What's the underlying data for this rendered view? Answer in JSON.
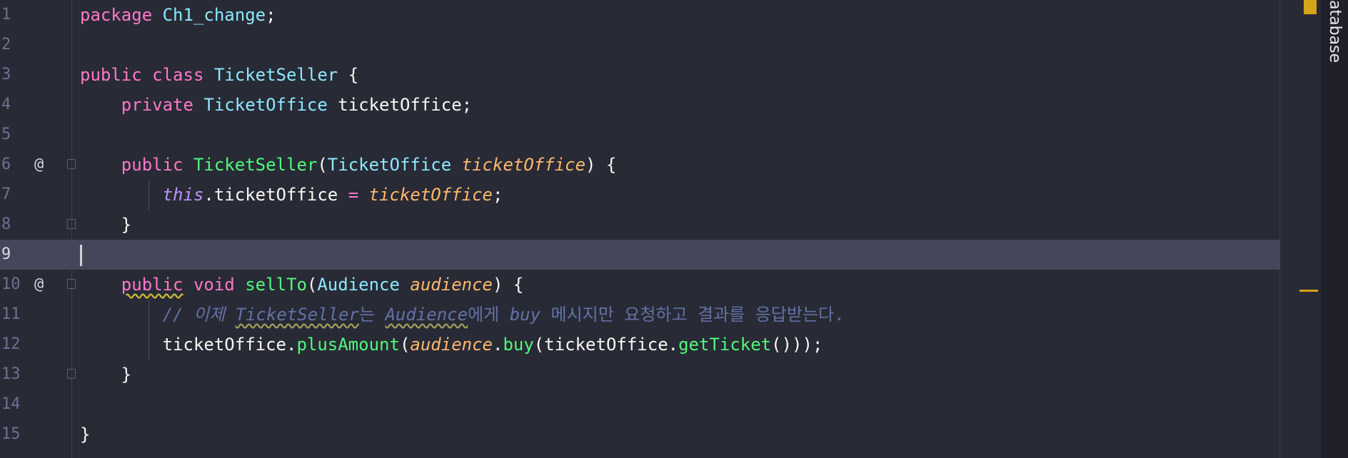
{
  "editor": {
    "language": "java",
    "current_line": 9,
    "lines": [
      {
        "n": "1",
        "mark": ""
      },
      {
        "n": "2",
        "mark": ""
      },
      {
        "n": "3",
        "mark": ""
      },
      {
        "n": "4",
        "mark": ""
      },
      {
        "n": "5",
        "mark": ""
      },
      {
        "n": "6",
        "mark": "@"
      },
      {
        "n": "7",
        "mark": ""
      },
      {
        "n": "8",
        "mark": ""
      },
      {
        "n": "9",
        "mark": ""
      },
      {
        "n": "10",
        "mark": "@"
      },
      {
        "n": "11",
        "mark": ""
      },
      {
        "n": "12",
        "mark": ""
      },
      {
        "n": "13",
        "mark": ""
      },
      {
        "n": "14",
        "mark": ""
      },
      {
        "n": "15",
        "mark": ""
      }
    ],
    "tokens": {
      "l1_package": "package",
      "l1_name": "Ch1_change",
      "l1_semi": ";",
      "l3_public": "public",
      "l3_class": "class",
      "l3_name": "TicketSeller",
      "l3_brace": " {",
      "l4_private": "private",
      "l4_type": "TicketOffice",
      "l4_field": " ticketOffice;",
      "l6_public": "public",
      "l6_ctor": "TicketSeller",
      "l6_paren_open": "(",
      "l6_type": "TicketOffice",
      "l6_param": "ticketOffice",
      "l6_tail": ") {",
      "l7_this": "this",
      "l7_field": ".ticketOffice ",
      "l7_eq": "=",
      "l7_param": "ticketOffice",
      "l7_semi": ";",
      "l8_brace": "}",
      "l10_public": "public",
      "l10_void": "void",
      "l10_method": "sellTo",
      "l10_paren_open": "(",
      "l10_type": "Audience",
      "l10_param": "audience",
      "l10_tail": ") {",
      "l11_c1": "// 이제 ",
      "l11_c2": "TicketSeller",
      "l11_c3": "는 ",
      "l11_c4": "Audience",
      "l11_c5": "에게 ",
      "l11_c6": "buy",
      "l11_c7": " 메시지만 요청하고 결과를 응답받는다.",
      "l12_obj": "ticketOffice.",
      "l12_plus": "plusAmount",
      "l12_open": "(",
      "l12_aud": "audience",
      "l12_dot": ".",
      "l12_buy": "buy",
      "l12_mid": "(ticketOffice.",
      "l12_get": "getTicket",
      "l12_end": "()));",
      "l13_brace": "}",
      "l15_brace": "}"
    }
  },
  "sidebar": {
    "tool_window_label": "atabase"
  },
  "colors": {
    "background": "#282a36",
    "current_line": "#44475a",
    "keyword": "#ff79c6",
    "type": "#8be9fd",
    "function": "#50fa7b",
    "parameter": "#ffb86c",
    "comment": "#6272a4",
    "marker": "#d4a419"
  }
}
